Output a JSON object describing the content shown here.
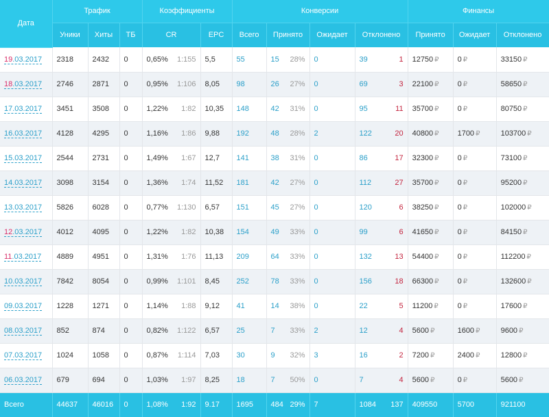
{
  "header": {
    "date": "Дата",
    "groups": {
      "traffic": "Трафик",
      "ratios": "Коэффициенты",
      "conversions": "Конверсии",
      "finance": "Финансы"
    },
    "cols": [
      "Уники",
      "Хиты",
      "ТБ",
      "CR",
      "EPC",
      "Всего",
      "Принято",
      "Ожидает",
      "Отклонено",
      "Принято",
      "Ожидает",
      "Отклонено"
    ]
  },
  "currency_symbol": "₽",
  "rows": [
    {
      "date_day": "19",
      "date_rest": ".03.2017",
      "weekend": true,
      "uniq": "2318",
      "hits": "2432",
      "tb": "0",
      "cr": "0,65%",
      "cr_ratio": "1:155",
      "epc": "5,5",
      "total": "55",
      "acc": "15",
      "acc_pct": "28%",
      "wait": "0",
      "rej": "39",
      "rej_extra": "1",
      "f_acc": "12750",
      "f_wait": "0",
      "f_rej": "33150"
    },
    {
      "date_day": "18",
      "date_rest": ".03.2017",
      "weekend": true,
      "uniq": "2746",
      "hits": "2871",
      "tb": "0",
      "cr": "0,95%",
      "cr_ratio": "1:106",
      "epc": "8,05",
      "total": "98",
      "acc": "26",
      "acc_pct": "27%",
      "wait": "0",
      "rej": "69",
      "rej_extra": "3",
      "f_acc": "22100",
      "f_wait": "0",
      "f_rej": "58650"
    },
    {
      "date_day": "17",
      "date_rest": ".03.2017",
      "weekend": false,
      "uniq": "3451",
      "hits": "3508",
      "tb": "0",
      "cr": "1,22%",
      "cr_ratio": "1:82",
      "epc": "10,35",
      "total": "148",
      "acc": "42",
      "acc_pct": "31%",
      "wait": "0",
      "rej": "95",
      "rej_extra": "11",
      "f_acc": "35700",
      "f_wait": "0",
      "f_rej": "80750"
    },
    {
      "date_day": "16",
      "date_rest": ".03.2017",
      "weekend": false,
      "uniq": "4128",
      "hits": "4295",
      "tb": "0",
      "cr": "1,16%",
      "cr_ratio": "1:86",
      "epc": "9,88",
      "total": "192",
      "acc": "48",
      "acc_pct": "28%",
      "wait": "2",
      "rej": "122",
      "rej_extra": "20",
      "f_acc": "40800",
      "f_wait": "1700",
      "f_rej": "103700"
    },
    {
      "date_day": "15",
      "date_rest": ".03.2017",
      "weekend": false,
      "uniq": "2544",
      "hits": "2731",
      "tb": "0",
      "cr": "1,49%",
      "cr_ratio": "1:67",
      "epc": "12,7",
      "total": "141",
      "acc": "38",
      "acc_pct": "31%",
      "wait": "0",
      "rej": "86",
      "rej_extra": "17",
      "f_acc": "32300",
      "f_wait": "0",
      "f_rej": "73100"
    },
    {
      "date_day": "14",
      "date_rest": ".03.2017",
      "weekend": false,
      "uniq": "3098",
      "hits": "3154",
      "tb": "0",
      "cr": "1,36%",
      "cr_ratio": "1:74",
      "epc": "11,52",
      "total": "181",
      "acc": "42",
      "acc_pct": "27%",
      "wait": "0",
      "rej": "112",
      "rej_extra": "27",
      "f_acc": "35700",
      "f_wait": "0",
      "f_rej": "95200"
    },
    {
      "date_day": "13",
      "date_rest": ".03.2017",
      "weekend": false,
      "uniq": "5826",
      "hits": "6028",
      "tb": "0",
      "cr": "0,77%",
      "cr_ratio": "1:130",
      "epc": "6,57",
      "total": "151",
      "acc": "45",
      "acc_pct": "27%",
      "wait": "0",
      "rej": "120",
      "rej_extra": "6",
      "f_acc": "38250",
      "f_wait": "0",
      "f_rej": "102000"
    },
    {
      "date_day": "12",
      "date_rest": ".03.2017",
      "weekend": true,
      "uniq": "4012",
      "hits": "4095",
      "tb": "0",
      "cr": "1,22%",
      "cr_ratio": "1:82",
      "epc": "10,38",
      "total": "154",
      "acc": "49",
      "acc_pct": "33%",
      "wait": "0",
      "rej": "99",
      "rej_extra": "6",
      "f_acc": "41650",
      "f_wait": "0",
      "f_rej": "84150"
    },
    {
      "date_day": "11",
      "date_rest": ".03.2017",
      "weekend": true,
      "uniq": "4889",
      "hits": "4951",
      "tb": "0",
      "cr": "1,31%",
      "cr_ratio": "1:76",
      "epc": "11,13",
      "total": "209",
      "acc": "64",
      "acc_pct": "33%",
      "wait": "0",
      "rej": "132",
      "rej_extra": "13",
      "f_acc": "54400",
      "f_wait": "0",
      "f_rej": "112200"
    },
    {
      "date_day": "10",
      "date_rest": ".03.2017",
      "weekend": false,
      "uniq": "7842",
      "hits": "8054",
      "tb": "0",
      "cr": "0,99%",
      "cr_ratio": "1:101",
      "epc": "8,45",
      "total": "252",
      "acc": "78",
      "acc_pct": "33%",
      "wait": "0",
      "rej": "156",
      "rej_extra": "18",
      "f_acc": "66300",
      "f_wait": "0",
      "f_rej": "132600"
    },
    {
      "date_day": "09",
      "date_rest": ".03.2017",
      "weekend": false,
      "uniq": "1228",
      "hits": "1271",
      "tb": "0",
      "cr": "1,14%",
      "cr_ratio": "1:88",
      "epc": "9,12",
      "total": "41",
      "acc": "14",
      "acc_pct": "38%",
      "wait": "0",
      "rej": "22",
      "rej_extra": "5",
      "f_acc": "11200",
      "f_wait": "0",
      "f_rej": "17600"
    },
    {
      "date_day": "08",
      "date_rest": ".03.2017",
      "weekend": false,
      "uniq": "852",
      "hits": "874",
      "tb": "0",
      "cr": "0,82%",
      "cr_ratio": "1:122",
      "epc": "6,57",
      "total": "25",
      "acc": "7",
      "acc_pct": "33%",
      "wait": "2",
      "rej": "12",
      "rej_extra": "4",
      "f_acc": "5600",
      "f_wait": "1600",
      "f_rej": "9600"
    },
    {
      "date_day": "07",
      "date_rest": ".03.2017",
      "weekend": false,
      "uniq": "1024",
      "hits": "1058",
      "tb": "0",
      "cr": "0,87%",
      "cr_ratio": "1:114",
      "epc": "7,03",
      "total": "30",
      "acc": "9",
      "acc_pct": "32%",
      "wait": "3",
      "rej": "16",
      "rej_extra": "2",
      "f_acc": "7200",
      "f_wait": "2400",
      "f_rej": "12800"
    },
    {
      "date_day": "06",
      "date_rest": ".03.2017",
      "weekend": false,
      "uniq": "679",
      "hits": "694",
      "tb": "0",
      "cr": "1,03%",
      "cr_ratio": "1:97",
      "epc": "8,25",
      "total": "18",
      "acc": "7",
      "acc_pct": "50%",
      "wait": "0",
      "rej": "7",
      "rej_extra": "4",
      "f_acc": "5600",
      "f_wait": "0",
      "f_rej": "5600"
    }
  ],
  "totals": {
    "label": "Всего",
    "uniq": "44637",
    "hits": "46016",
    "tb": "0",
    "cr": "1,08%",
    "cr_ratio": "1:92",
    "epc": "9.17",
    "total": "1695",
    "acc": "484",
    "acc_pct": "29%",
    "wait": "7",
    "rej": "1084",
    "rej_extra": "137",
    "f_acc": "409550",
    "f_wait": "5700",
    "f_rej": "921100"
  }
}
